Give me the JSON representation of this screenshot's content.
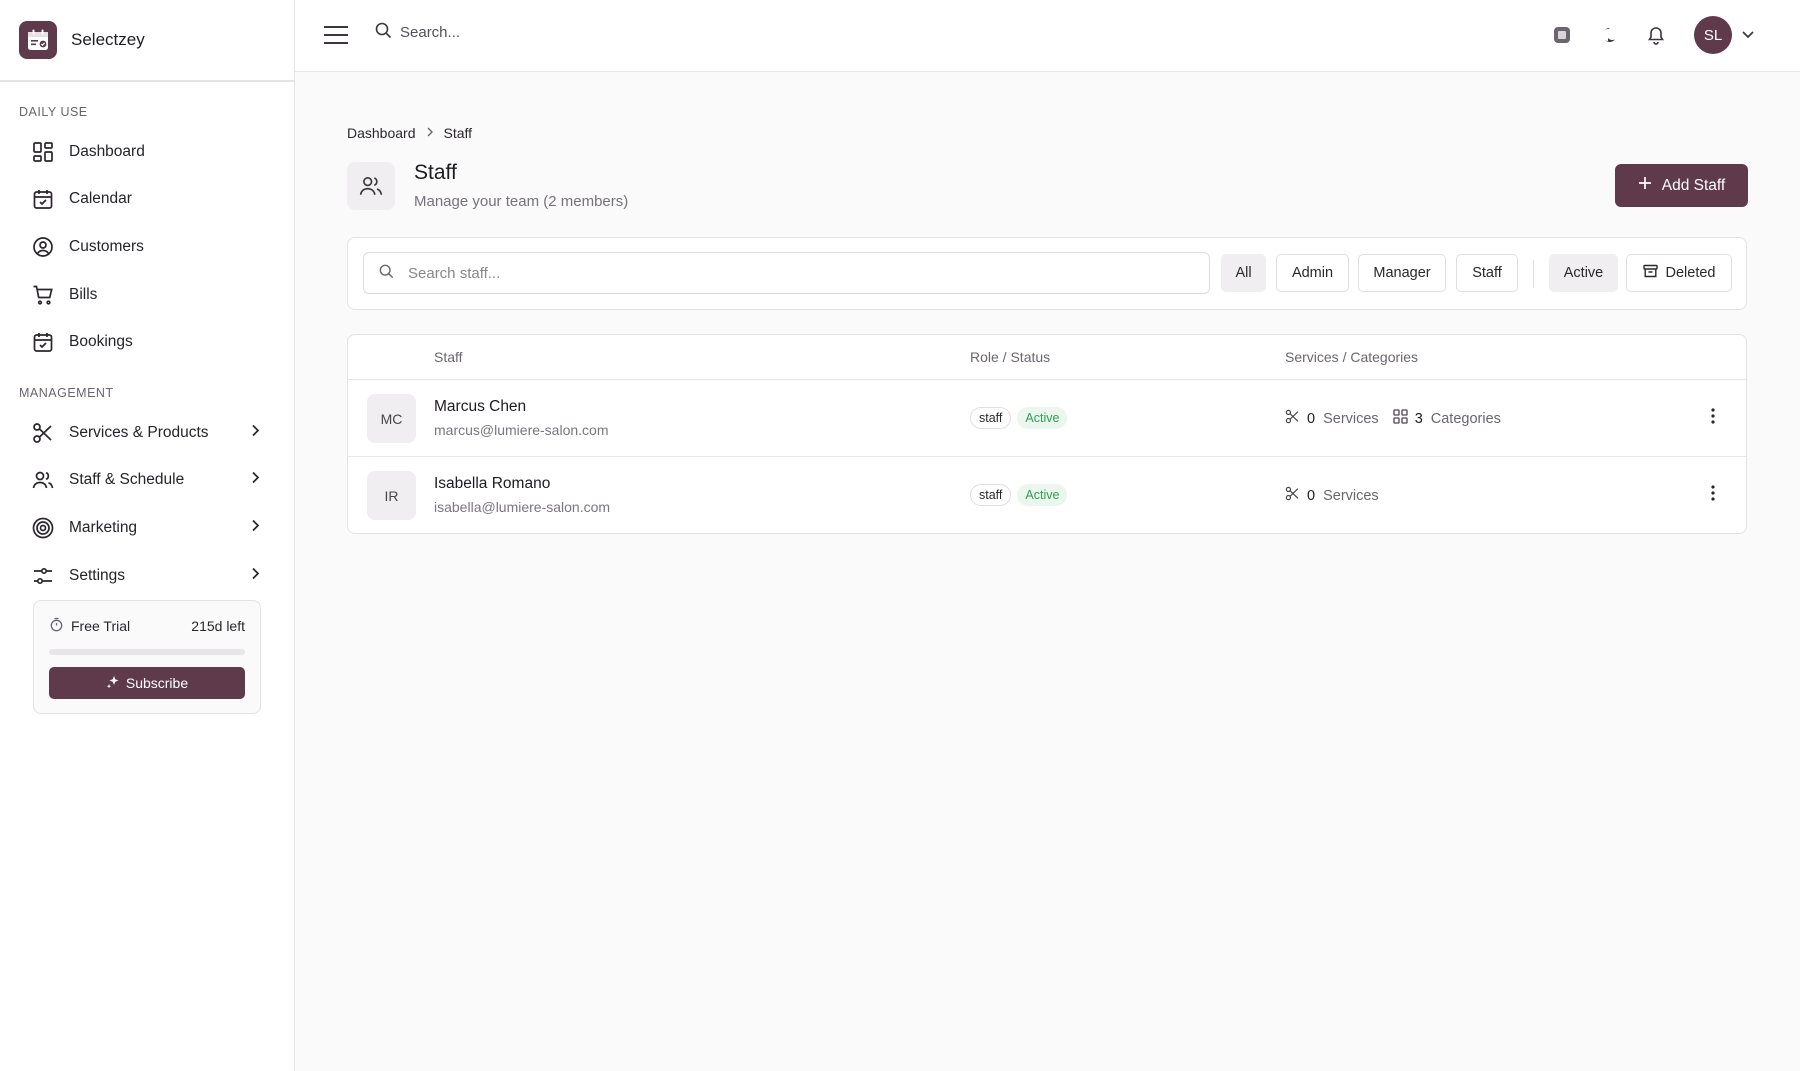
{
  "brand": {
    "name": "Selectzey"
  },
  "sidebar": {
    "sections": [
      {
        "label": "DAILY USE"
      },
      {
        "label": "MANAGEMENT"
      }
    ],
    "daily_items": [
      {
        "label": "Dashboard",
        "icon": "dashboard-icon"
      },
      {
        "label": "Calendar",
        "icon": "calendar-icon"
      },
      {
        "label": "Customers",
        "icon": "user-circle-icon"
      },
      {
        "label": "Bills",
        "icon": "cart-icon"
      },
      {
        "label": "Bookings",
        "icon": "calendar-check-icon"
      }
    ],
    "management_items": [
      {
        "label": "Services & Products",
        "icon": "scissors-icon"
      },
      {
        "label": "Staff & Schedule",
        "icon": "users-icon"
      },
      {
        "label": "Marketing",
        "icon": "target-icon"
      },
      {
        "label": "Settings",
        "icon": "sliders-icon"
      }
    ],
    "trial": {
      "label": "Free Trial",
      "remaining": "215d left",
      "progress": 0.0,
      "button": "Subscribe"
    }
  },
  "topbar": {
    "search_placeholder": "Search...",
    "avatar_initials": "SL"
  },
  "breadcrumb": {
    "items": [
      "Dashboard",
      "Staff"
    ]
  },
  "page": {
    "title": "Staff",
    "subtitle": "Manage your team (2 members)",
    "add_button": "Add Staff"
  },
  "filters": {
    "search_placeholder": "Search staff...",
    "roles": [
      "All",
      "Admin",
      "Manager",
      "Staff"
    ],
    "selected_role": "All",
    "statuses": [
      "Active",
      "Deleted"
    ],
    "selected_status": "Active"
  },
  "table": {
    "headers": [
      "Staff",
      "Role / Status",
      "Services / Categories"
    ],
    "rows": [
      {
        "initials": "MC",
        "name": "Marcus Chen",
        "email": "marcus@lumiere-salon.com",
        "role": "staff",
        "status": "Active",
        "services_count": "0",
        "services_label": "Services",
        "categories_count": "3",
        "categories_label": "Categories"
      },
      {
        "initials": "IR",
        "name": "Isabella Romano",
        "email": "isabella@lumiere-salon.com",
        "role": "staff",
        "status": "Active",
        "services_count": "0",
        "services_label": "Services"
      }
    ]
  },
  "colors": {
    "accent": "#5e3a4b",
    "active_green": "#2f9e57",
    "active_bg": "#eaf6ee"
  }
}
